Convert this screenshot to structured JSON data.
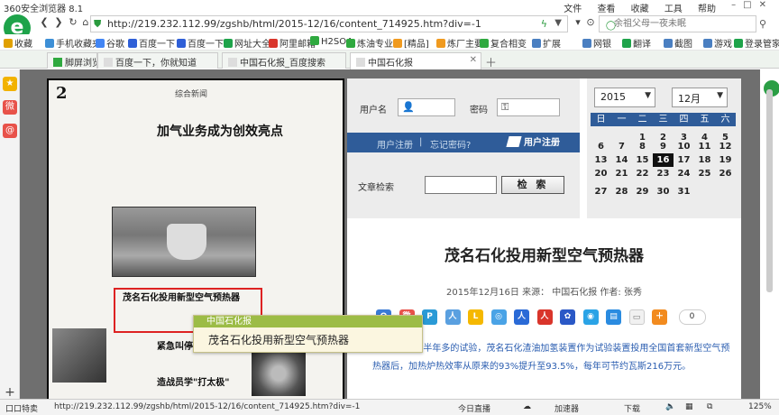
{
  "window": {
    "title": "360安全浏览器 8.1",
    "menus": [
      "文件",
      "查看",
      "收藏",
      "工具",
      "帮助"
    ]
  },
  "address": {
    "url": "http://219.232.112.99/zgshb/html/2015-12/16/content_714925.htm?div=-1",
    "search_placeholder": "余祖父母一夜未眠"
  },
  "bookmarks": [
    {
      "label": "收藏",
      "color": "#e0a000"
    },
    {
      "label": "手机收藏夹",
      "color": "#3d8fd6"
    },
    {
      "label": "谷歌",
      "color": "#4285f4"
    },
    {
      "label": "百度一下",
      "color": "#2f5fd7"
    },
    {
      "label": "百度一下",
      "color": "#2f5fd7"
    },
    {
      "label": "网址大全",
      "color": "#1ea34a"
    },
    {
      "label": "阿里邮箱",
      "color": "#d9352b"
    },
    {
      "label": "H2SO4",
      "color": "#2fa93f"
    },
    {
      "label": "炼油专业",
      "color": "#2fa93f"
    },
    {
      "label": "[精品]",
      "color": "#f09a1f"
    },
    {
      "label": "炼厂主要",
      "color": "#f09a1f"
    },
    {
      "label": "复合相变",
      "color": "#2fa93f"
    },
    {
      "label": "扩展",
      "color": "#4a7fc1"
    },
    {
      "label": "网银",
      "color": "#4a7fc1"
    },
    {
      "label": "翻译",
      "color": "#1ea34a"
    },
    {
      "label": "截图",
      "color": "#4a7fc1"
    },
    {
      "label": "游戏",
      "color": "#4a7fc1"
    },
    {
      "label": "登录管家",
      "color": "#1ea34a"
    }
  ],
  "tabs": [
    {
      "label": "脚屏浏览",
      "active": false
    },
    {
      "label": "百度一下，你就知道",
      "active": false
    },
    {
      "label": "中国石化报_百度搜索",
      "active": false
    },
    {
      "label": "中国石化报",
      "active": true
    }
  ],
  "paper": {
    "page_number": "2",
    "section": "综合新闻",
    "headline": "加气业务成为创效亮点",
    "boxed_title": "茂名石化投用新型空气预热器",
    "title2": "紧急叫停",
    "title3": "造战员学\"打太极\""
  },
  "tooltip": {
    "header": "中国石化报",
    "text": "茂名石化投用新型空气预热器"
  },
  "login": {
    "username_label": "用户名",
    "password_label": "密码",
    "register_link": "用户注册",
    "separator": "|",
    "forgot_link": "忘记密码?",
    "register_button": "用户注册",
    "archive_label": "文章检索",
    "search_button": "检 索"
  },
  "calendar": {
    "year": "2015",
    "month": "12月",
    "weekdays": [
      "日",
      "一",
      "二",
      "三",
      "四",
      "五",
      "六"
    ],
    "weeks": [
      [
        "",
        "",
        "1",
        "2",
        "3",
        "4",
        "5"
      ],
      [
        "6",
        "7",
        "8",
        "9",
        "10",
        "11",
        "12"
      ],
      [
        "13",
        "14",
        "15",
        "16",
        "17",
        "18",
        "19"
      ],
      [
        "20",
        "21",
        "22",
        "23",
        "24",
        "25",
        "26"
      ],
      [
        "27",
        "28",
        "29",
        "30",
        "31",
        "",
        ""
      ]
    ],
    "today": "16"
  },
  "article": {
    "title": "茂名石化投用新型空气预热器",
    "meta": "2015年12月16日 来源： 中国石化报 作者: 张秀",
    "share_count": "0",
    "body": "月6日，经过半年多的试验，茂名石化渣油加氢装置作为试验装置投用全国首套新型空气预热器后，加热炉热效率从原来的93%提升至93.5%，每年可节约瓦斯216万元。"
  },
  "status": {
    "left": "口口特卖",
    "url": "http://219.232.112.99/zgshb/html/2015-12/16/content_714925.htm?div=-1",
    "live": "今日直播",
    "downloads_label": "加速器",
    "download": "下载",
    "zoom": "125%"
  }
}
